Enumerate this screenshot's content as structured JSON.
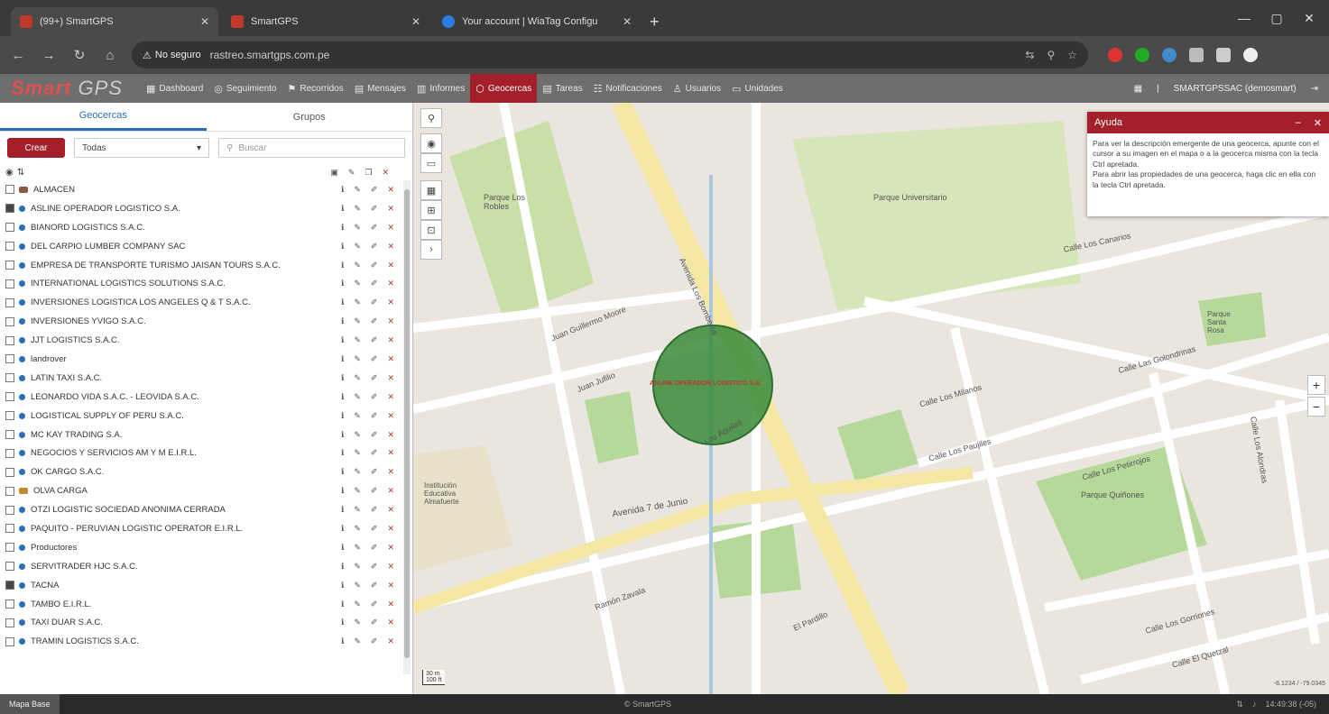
{
  "browser": {
    "tabs": [
      {
        "title": "(99+) SmartGPS",
        "active": true
      },
      {
        "title": "SmartGPS",
        "active": false
      },
      {
        "title": "Your account | WiaTag Configu",
        "active": false
      }
    ],
    "insecure_label": "No seguro",
    "url": "rastreo.smartgps.com.pe"
  },
  "app": {
    "logo_smart": "Smart",
    "logo_gps": "GPS",
    "menu": [
      {
        "label": "Dashboard",
        "icon": "▦",
        "active": false
      },
      {
        "label": "Seguimiento",
        "icon": "◎",
        "active": false
      },
      {
        "label": "Recorridos",
        "icon": "⚑",
        "active": false
      },
      {
        "label": "Mensajes",
        "icon": "▤",
        "active": false
      },
      {
        "label": "Informes",
        "icon": "▥",
        "active": false
      },
      {
        "label": "Geocercas",
        "icon": "⬡",
        "active": true
      },
      {
        "label": "Tareas",
        "icon": "▤",
        "active": false
      },
      {
        "label": "Notificaciones",
        "icon": "☷",
        "active": false
      },
      {
        "label": "Usuarios",
        "icon": "♙",
        "active": false
      },
      {
        "label": "Unidades",
        "icon": "▭",
        "active": false
      }
    ],
    "user": "SMARTGPSSAC (demosmart)"
  },
  "panel": {
    "tab_geocercas": "Geocercas",
    "tab_grupos": "Grupos",
    "crear_label": "Crear",
    "filter_value": "Todas",
    "search_placeholder": "Buscar",
    "items": [
      {
        "name": "ALMACEN",
        "checked": false,
        "icon": "brown"
      },
      {
        "name": "ASLINE OPERADOR LOGISTICO S.A.",
        "checked": true,
        "icon": "blue"
      },
      {
        "name": "BIANORD LOGISTICS S.A.C.",
        "checked": false,
        "icon": "blue"
      },
      {
        "name": "DEL CARPIO LUMBER COMPANY SAC",
        "checked": false,
        "icon": "blue"
      },
      {
        "name": "EMPRESA DE TRANSPORTE TURISMO JAISAN TOURS S.A.C.",
        "checked": false,
        "icon": "blue"
      },
      {
        "name": "INTERNATIONAL LOGISTICS SOLUTIONS S.A.C.",
        "checked": false,
        "icon": "blue"
      },
      {
        "name": "INVERSIONES LOGISTICA LOS ANGELES Q & T S.A.C.",
        "checked": false,
        "icon": "blue"
      },
      {
        "name": "INVERSIONES YVIGO S.A.C.",
        "checked": false,
        "icon": "blue"
      },
      {
        "name": "JJT LOGISTICS S.A.C.",
        "checked": false,
        "icon": "blue"
      },
      {
        "name": "landrover",
        "checked": false,
        "icon": "blue"
      },
      {
        "name": "LATIN TAXI S.A.C.",
        "checked": false,
        "icon": "blue"
      },
      {
        "name": "LEONARDO VIDA S.A.C. - LEOVIDA S.A.C.",
        "checked": false,
        "icon": "blue"
      },
      {
        "name": "LOGISTICAL SUPPLY OF PERU S.A.C.",
        "checked": false,
        "icon": "blue"
      },
      {
        "name": "MC KAY TRADING S.A.",
        "checked": false,
        "icon": "blue"
      },
      {
        "name": "NEGOCIOS Y SERVICIOS AM Y M E.I.R.L.",
        "checked": false,
        "icon": "blue"
      },
      {
        "name": "OK CARGO S.A.C.",
        "checked": false,
        "icon": "blue"
      },
      {
        "name": "OLVA CARGA",
        "checked": false,
        "icon": "amber"
      },
      {
        "name": "OTZI LOGISTIC SOCIEDAD ANONIMA CERRADA",
        "checked": false,
        "icon": "blue"
      },
      {
        "name": "PAQUITO - PERUVIAN LOGISTIC OPERATOR E.I.R.L.",
        "checked": false,
        "icon": "blue"
      },
      {
        "name": "Productores",
        "checked": false,
        "icon": "blue"
      },
      {
        "name": "SERVITRADER HJC S.A.C.",
        "checked": false,
        "icon": "blue"
      },
      {
        "name": "TACNA",
        "checked": true,
        "icon": "blue"
      },
      {
        "name": "TAMBO E.I.R.L.",
        "checked": false,
        "icon": "blue"
      },
      {
        "name": "TAXI DUAR S.A.C.",
        "checked": false,
        "icon": "blue"
      },
      {
        "name": "TRAMIN LOGISTICS S.A.C.",
        "checked": false,
        "icon": "blue"
      }
    ]
  },
  "map": {
    "labels": {
      "parque_robles": "Parque Los Robles",
      "parque_universitario": "Parque Universitario",
      "calle_los_canarios": "Calle Los Canarios",
      "calle_los_milanos": "Calle Los Milanos",
      "calle_los_paujiles": "Calle Los Paujiles",
      "calle_los_petirrojos": "Calle Los Petirrojos",
      "parque_quiliones": "Parque Quiñones",
      "avenida_7_junio": "Avenida 7 de Junio",
      "juan_guillermo_moore": "Juan Guillermo Moore",
      "juan_jufilio": "Juan Jufilio",
      "avenida_bomberos": "Avenida Los Bomberos",
      "institucion": "Institución Educativa Almafuerte",
      "parque_santa_rosa": "Parque Santa Rosa",
      "calle_el_quetzal": "Calle El Quetzal",
      "calle_los_gorriones": "Calle Los Gorriones",
      "ramon_zavala": "Ramón Zavala",
      "el_pardillo": "El Pardillo",
      "los_aguilas": "Los Águilas",
      "calle_las_golondrinas": "Calle Las Golondrinas",
      "calle_los_alondras": "Calle Los Alondras"
    },
    "geofence_label": "ASLINE OPERADOR LOGISTICO S.A.",
    "scale_top": "30 m",
    "scale_bottom": "100 ft",
    "coords": "-8.1234 / -79.0345",
    "zoom_in": "+",
    "zoom_out": "−"
  },
  "help": {
    "title": "Ayuda",
    "text1": "Para ver la descripción emergente de una geocerca, apunte con el cursor a su imagen en el mapa o a la geocerca misma con la tecla Ctrl apretada.",
    "text2": "Para abrir las propiedades de una geocerca, haga clic en ella con la tecla Ctrl apretada."
  },
  "status": {
    "left": "Mapa Base",
    "center": "© SmartGPS",
    "time": "14:49:38 (-05)"
  },
  "colors": {
    "accent": "#a3202a",
    "geofence": "#3a8a3a",
    "park": "#c8dfa8"
  }
}
